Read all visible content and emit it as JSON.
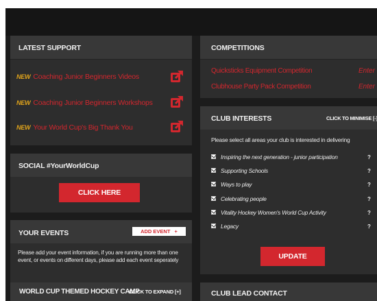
{
  "latest_support": {
    "title": "LATEST SUPPORT",
    "new_badge": "NEW",
    "items": [
      {
        "label": "Coaching Junior Beginners Videos"
      },
      {
        "label": "Coaching Junior Beginners Workshops"
      },
      {
        "label": "Your World Cup's Big Thank You"
      }
    ],
    "link_icon": "external-link-icon"
  },
  "social": {
    "title": "SOCIAL #YourWorldCup",
    "button_label": "CLICK HERE"
  },
  "events": {
    "title": "YOUR EVENTS",
    "add_label": "ADD EVENT",
    "add_symbol": "+",
    "description": "Please add your event information, if you are running more than one event, or events on different days, please add each event seperately",
    "event_title": "WORLD CUP THEMED HOCKEY CAMP",
    "expand_label": "CLICK TO EXPAND [+]"
  },
  "competitions": {
    "title": "COMPETITIONS",
    "items": [
      {
        "label": "Quicksticks Equipment Competition",
        "action": "Enter"
      },
      {
        "label": "Clubhouse Party Pack Competition",
        "action": "Enter"
      }
    ]
  },
  "club_interests": {
    "title": "CLUB INTERESTS",
    "minimise_label": "CLICK TO MINIMISE [-]",
    "intro": "Please select all areas your club is interested in delivering",
    "help_symbol": "?",
    "options": [
      {
        "label": "Inspiring the next generation - junior participation",
        "checked": true
      },
      {
        "label": "Supporting Schools",
        "checked": true
      },
      {
        "label": "Ways to play",
        "checked": true
      },
      {
        "label": "Celebrating people",
        "checked": true
      },
      {
        "label": "Vitality Hockey Women's World Cup Activity",
        "checked": true
      },
      {
        "label": "Legacy",
        "checked": true
      }
    ],
    "update_label": "UPDATE"
  },
  "club_lead": {
    "title": "CLUB LEAD CONTACT"
  },
  "colors": {
    "accent": "#d3272e",
    "new_badge": "#e1a41b",
    "panel": "#2d2d2d",
    "panel_header": "#383838",
    "background": "#1c1c1c"
  }
}
